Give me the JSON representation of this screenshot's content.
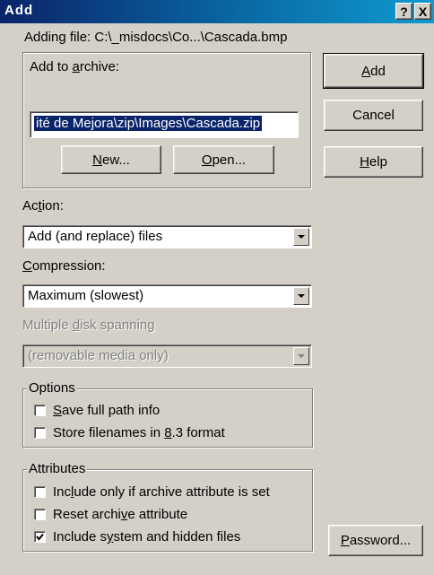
{
  "window": {
    "title": "Add",
    "help_glyph": "?",
    "close_glyph": "X"
  },
  "adding_file": "Adding file: C:\\_misdocs\\Co...\\Cascada.bmp",
  "archive_group": {
    "label_prefix": "Add to ",
    "label_mnemonic": "a",
    "label_suffix": "rchive:",
    "path_value": "ité de Mejora\\zip\\Images\\Cascada.zip",
    "new_button": {
      "mnemonic": "N",
      "rest": "ew..."
    },
    "open_button": {
      "mnemonic": "O",
      "rest": "pen..."
    }
  },
  "buttons": {
    "add": {
      "mnemonic": "A",
      "rest": "dd"
    },
    "cancel": "Cancel",
    "help": {
      "mnemonic": "H",
      "rest": "elp"
    },
    "password": {
      "mnemonic": "P",
      "rest": "assword..."
    }
  },
  "action": {
    "label_prefix": "Ac",
    "label_mnemonic": "t",
    "label_suffix": "ion:",
    "selected": "Add (and replace) files"
  },
  "compression": {
    "label_mnemonic": "C",
    "label_suffix": "ompression:",
    "selected": "Maximum (slowest)"
  },
  "spanning": {
    "label_prefix": "Multiple ",
    "label_mnemonic": "d",
    "label_suffix": "isk spanning",
    "selected": "(removable media only)",
    "enabled": false
  },
  "options": {
    "label": "Options",
    "items": [
      {
        "mnemonic": "S",
        "pre": "",
        "post": "ave full path info",
        "checked": false
      },
      {
        "mnemonic": "8",
        "pre": "Store filenames in ",
        "post": ".3 format",
        "checked": false
      }
    ]
  },
  "attributes": {
    "label": "Attributes",
    "items": [
      {
        "pre": "Inc",
        "mnemonic": "l",
        "post": "ude only if archive attribute is set",
        "checked": false
      },
      {
        "pre": "Reset archi",
        "mnemonic": "v",
        "post": "e attribute",
        "checked": false
      },
      {
        "pre": "Include s",
        "mnemonic": "y",
        "post": "stem and hidden files",
        "checked": true
      }
    ]
  }
}
